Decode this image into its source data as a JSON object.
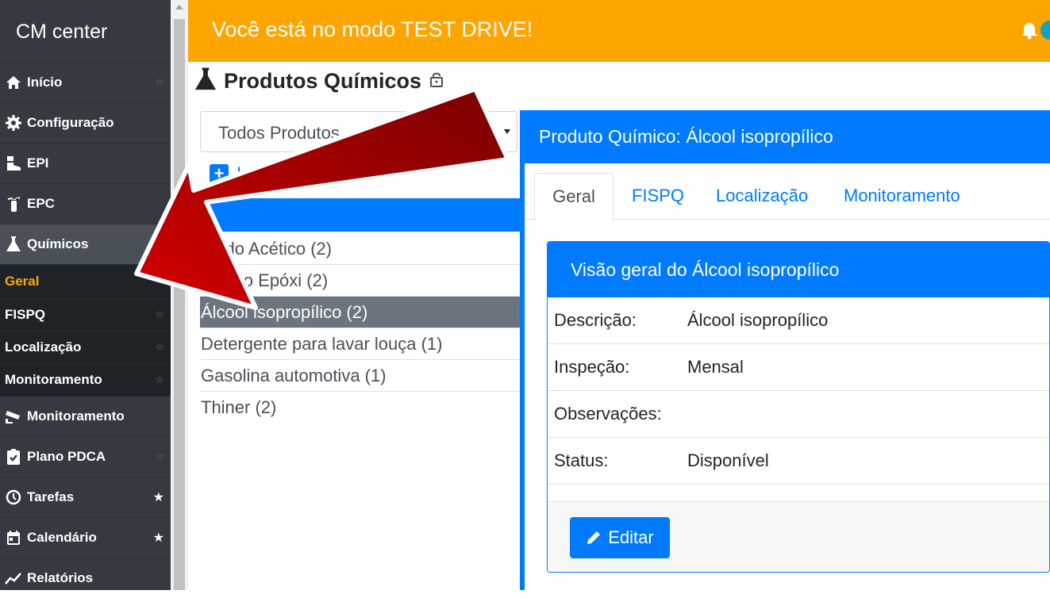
{
  "sidebar": {
    "brand": "CM center",
    "items": [
      {
        "label": "Início",
        "icon": "home-icon"
      },
      {
        "label": "Configuração",
        "icon": "gear-icon"
      },
      {
        "label": "EPI",
        "icon": "boot-icon"
      },
      {
        "label": "EPC",
        "icon": "fire-extinguisher-icon"
      },
      {
        "label": "Químicos",
        "icon": "flask-icon"
      }
    ],
    "subitems": [
      {
        "label": "Geral"
      },
      {
        "label": "FISPQ"
      },
      {
        "label": "Localização"
      },
      {
        "label": "Monitoramento"
      }
    ],
    "items_bottom": [
      {
        "label": "Monitoramento",
        "icon": "camera-icon"
      },
      {
        "label": "Plano PDCA",
        "icon": "clipboard-check-icon"
      },
      {
        "label": "Tarefas",
        "icon": "clock-icon"
      },
      {
        "label": "Calendário",
        "icon": "calendar-icon"
      },
      {
        "label": "Relatórios",
        "icon": "chart-line-icon"
      }
    ],
    "star_empty": "☆",
    "star_full": "★"
  },
  "banner": {
    "text": "Você está no modo TEST DRIVE!"
  },
  "page": {
    "title": "Produtos Químicos"
  },
  "filter": {
    "value": "Todos Produtos"
  },
  "insert": {
    "label": "Ins"
  },
  "products": [
    {
      "label": "Ácido Acético (2)"
    },
    {
      "label": "Aditivo Epóxi (2)"
    },
    {
      "label": "Álcool isopropílico (2)"
    },
    {
      "label": "Detergente para lavar louça (1)"
    },
    {
      "label": "Gasolina automotiva (1)"
    },
    {
      "label": "Thiner (2)"
    }
  ],
  "panel": {
    "title": "Produto Químico: Álcool isopropílico",
    "tabs": [
      "Geral",
      "FISPQ",
      "Localização",
      "Monitoramento"
    ],
    "card_title": "Visão geral do Álcool isopropílico",
    "rows": [
      {
        "label": "Descrição:",
        "value": "Álcool isopropílico"
      },
      {
        "label": "Inspeção:",
        "value": "Mensal"
      },
      {
        "label": "Observações:",
        "value": ""
      },
      {
        "label": "Status:",
        "value": "Disponível"
      }
    ],
    "edit_label": "Editar"
  },
  "colors": {
    "sidebar": "#343a40",
    "banner": "#ffa500",
    "primary": "#007bff",
    "active_sub": "#ffa500",
    "arrow": "#b50000"
  }
}
